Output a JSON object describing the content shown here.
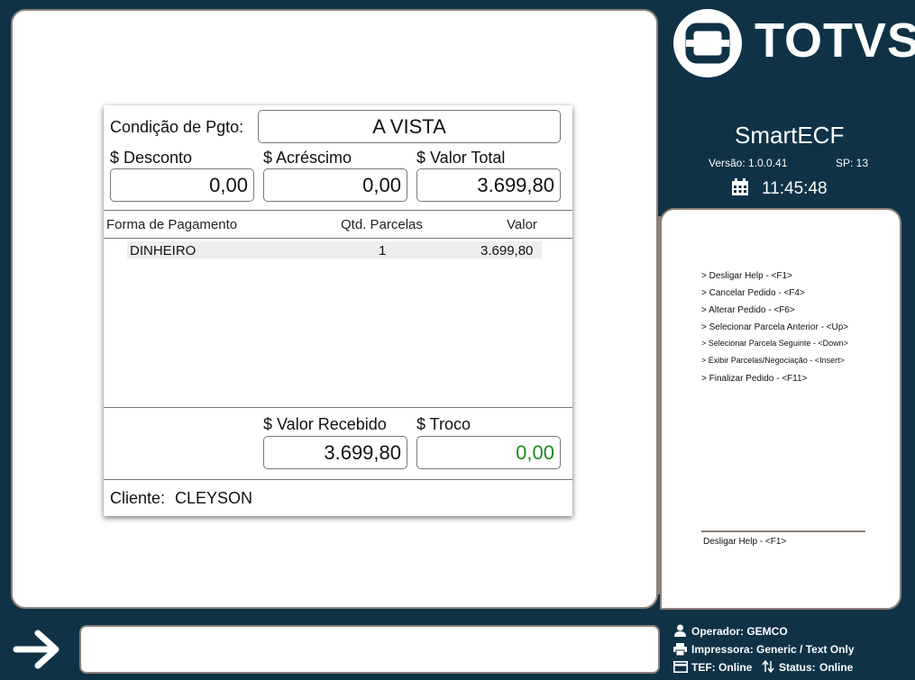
{
  "brand": {
    "name": "TOTVS"
  },
  "app": {
    "name": "SmartECF",
    "version_label": "Versão: 1.0.0.41",
    "sp_label": "SP: 13",
    "clock": "11:45:48"
  },
  "payment": {
    "condition_label": "Condição de Pgto:",
    "condition_value": "A VISTA",
    "desconto_label": "$ Desconto",
    "desconto_value": "0,00",
    "acrescimo_label": "$ Acréscimo",
    "acrescimo_value": "0,00",
    "total_label": "$ Valor Total",
    "total_value": "3.699,80",
    "table": {
      "headers": [
        "Forma de Pagamento",
        "Qtd. Parcelas",
        "Valor"
      ],
      "rows": [
        {
          "forma": "DINHEIRO",
          "qtd": "1",
          "valor": "3.699,80"
        }
      ]
    },
    "recebido_label": "$ Valor Recebido",
    "recebido_value": "3.699,80",
    "troco_label": "$ Troco",
    "troco_value": "0,00",
    "cliente_label": "Cliente:",
    "cliente_value": "CLEYSON"
  },
  "help": {
    "items": [
      "> Desligar Help - <F1>",
      "> Cancelar Pedido - <F4>",
      "> Alterar Pedido - <F6>",
      "> Selecionar Parcela Anterior - <Up>",
      "> Selecionar Parcela Seguinte - <Down>",
      "> Exibir Parcelas/Negociação - <Insert>",
      "> Finalizar Pedido - <F11>"
    ],
    "footer": "Desligar Help - <F1>"
  },
  "status": {
    "operador": "Operador: GEMCO",
    "impressora": "Impressora: Generic / Text Only",
    "tef": "TEF: Online",
    "status_label": "Status:",
    "status_value": "Online"
  },
  "colors": {
    "background": "#0f3246",
    "troco": "#1e8a1e",
    "border": "#8a8178"
  },
  "icons": [
    "totvs-logo-icon",
    "calendar-icon",
    "arrow-right-icon",
    "user-icon",
    "printer-icon",
    "card-icon",
    "transfer-icon"
  ]
}
